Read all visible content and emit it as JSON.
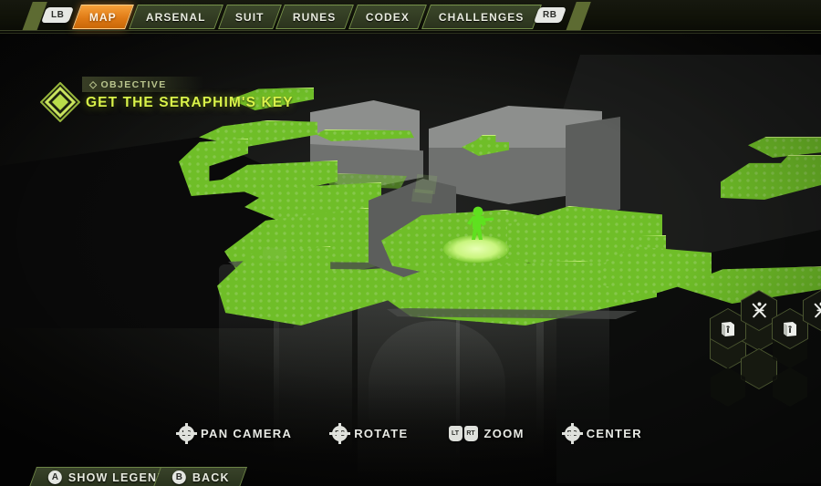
{
  "topbar": {
    "left_bumper": "LB",
    "right_bumper": "RB",
    "tabs": [
      {
        "label": "MAP",
        "active": true
      },
      {
        "label": "ARSENAL",
        "active": false
      },
      {
        "label": "SUIT",
        "active": false
      },
      {
        "label": "RUNES",
        "active": false
      },
      {
        "label": "CODEX",
        "active": false
      },
      {
        "label": "CHALLENGES",
        "active": false
      }
    ]
  },
  "objective": {
    "label": "OBJECTIVE",
    "diamond_glyph": "◇",
    "text": "GET THE SERAPHIM'S KEY"
  },
  "controls": [
    {
      "icon": "left-stick",
      "button": "LS",
      "label": "PAN CAMERA"
    },
    {
      "icon": "right-stick",
      "button": "RS",
      "label": "ROTATE"
    },
    {
      "icon": "triggers",
      "button_left": "LT",
      "button_right": "RT",
      "label": "ZOOM"
    },
    {
      "icon": "right-stick",
      "button": "RS",
      "label": "CENTER"
    }
  ],
  "bottom_buttons": [
    {
      "button": "A",
      "label": "SHOW LEGEND"
    },
    {
      "button": "B",
      "label": "BACK"
    }
  ],
  "hex_icons": [
    {
      "name": "codex-book",
      "glyph": "book"
    },
    {
      "name": "crossed-swords",
      "glyph": "swords"
    },
    {
      "name": "codex-book",
      "glyph": "book"
    },
    {
      "name": "crossed-swords",
      "glyph": "swords"
    }
  ],
  "colors": {
    "accent_green": "#6fbe28",
    "highlight_green": "#d9f24a",
    "active_tab_orange": "#e07b16",
    "panel_olive": "#3b472a",
    "geometry_grey": "#8d8f8d"
  },
  "map": {
    "player_marker": "player-position-marker"
  }
}
